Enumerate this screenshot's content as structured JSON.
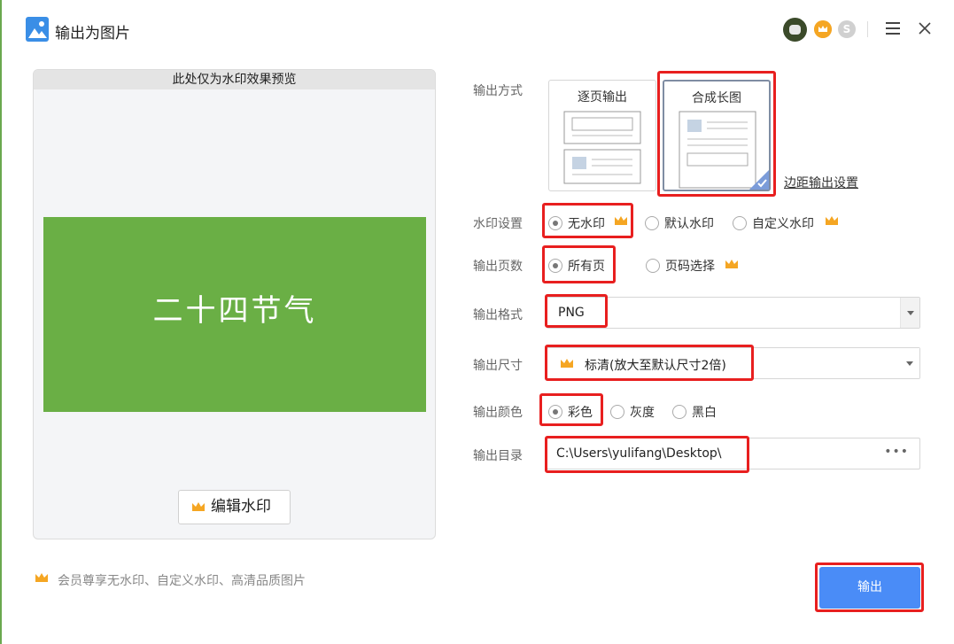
{
  "window": {
    "title": "输出为图片"
  },
  "preview": {
    "header": "此处仅为水印效果预览",
    "image_text": "二十四节气",
    "edit_watermark_label": "编辑水印"
  },
  "vip_note": "会员尊享无水印、自定义水印、高清品质图片",
  "form": {
    "output_mode": {
      "label": "输出方式",
      "options": [
        "逐页输出",
        "合成长图"
      ],
      "selected": "合成长图",
      "margin_link": "边距输出设置"
    },
    "watermark": {
      "label": "水印设置",
      "options": [
        "无水印",
        "默认水印",
        "自定义水印"
      ],
      "selected": "无水印"
    },
    "pages": {
      "label": "输出页数",
      "options": [
        "所有页",
        "页码选择"
      ],
      "selected": "所有页"
    },
    "format": {
      "label": "输出格式",
      "value": "PNG"
    },
    "size": {
      "label": "输出尺寸",
      "value": "标清(放大至默认尺寸2倍)"
    },
    "color": {
      "label": "输出颜色",
      "options": [
        "彩色",
        "灰度",
        "黑白"
      ],
      "selected": "彩色"
    },
    "directory": {
      "label": "输出目录",
      "value": "C:\\Users\\yulifang\\Desktop\\",
      "more": "•••"
    }
  },
  "export_label": "输出",
  "colors": {
    "accent": "#4a8cf7",
    "highlight": "#e81f1f",
    "preview_green": "#6aaf45",
    "crown": "#f5a623"
  },
  "icons": [
    "image-app-icon",
    "avatar",
    "vip-badge-icon",
    "s-badge-icon",
    "menu-icon",
    "close-icon",
    "crown-icon"
  ]
}
